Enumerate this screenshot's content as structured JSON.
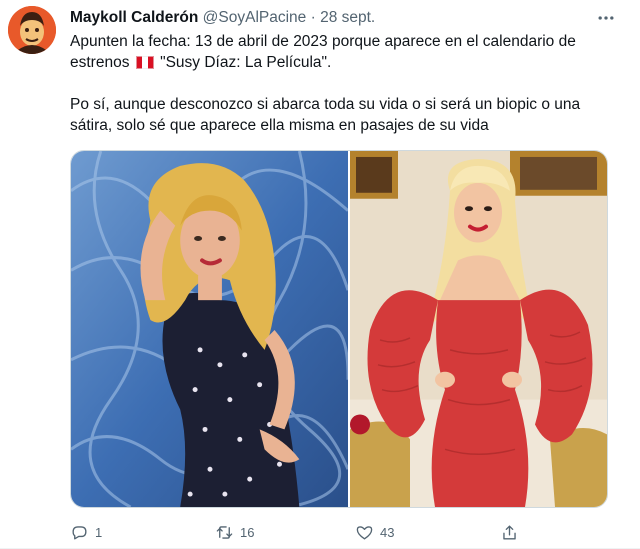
{
  "tweet": {
    "author_name": "Maykoll Calderón",
    "handle": "@SoyAlPacine",
    "separator": "·",
    "timestamp": "28 sept.",
    "text_part1": "Apunten la fecha: 13 de abril de 2023 porque aparece en el calendario de estrenos",
    "flag_icon": "peru-flag-emoji",
    "text_part2": "\"Susy Díaz: La Película\".",
    "text_paragraph2": "Po sí, aunque desconozco si abarca toda su vida o si será un biopic o una sátira, solo sé que aparece ella misma en pasajes de su vida",
    "media": [
      {
        "icon": "photo-young-blonde-woman-blue-backdrop"
      },
      {
        "icon": "photo-blonde-woman-red-dress"
      }
    ],
    "actions": {
      "reply_count": "1",
      "retweet_count": "16",
      "like_count": "43"
    }
  },
  "colors": {
    "text": "#0f1419",
    "secondary": "#536471",
    "avatar_bg": "#e8592a",
    "border": "#cfd9de"
  },
  "icons": {
    "more": "more-dots-icon",
    "reply": "reply-icon",
    "retweet": "retweet-icon",
    "like": "heart-icon",
    "share": "share-icon"
  }
}
